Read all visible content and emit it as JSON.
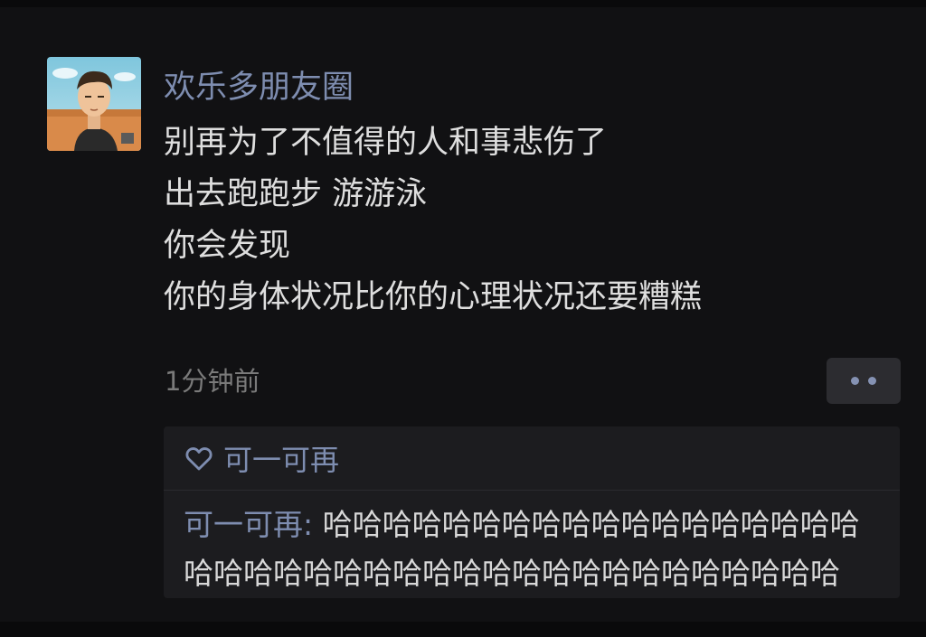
{
  "post": {
    "username": "欢乐多朋友圈",
    "lines": [
      "别再为了不值得的人和事悲伤了",
      "出去跑跑步 游游泳",
      "你会发现",
      "你的身体状况比你的心理状况还要糟糕"
    ],
    "timestamp": "1分钟前"
  },
  "likes": {
    "names": "可一可再"
  },
  "comment": {
    "author": "可一可再",
    "separator": ": ",
    "text": "哈哈哈哈哈哈哈哈哈哈哈哈哈哈哈哈哈哈哈哈哈哈哈哈哈哈哈哈哈哈哈哈哈哈哈哈哈哈哈哈"
  },
  "colors": {
    "background": "#111113",
    "name_link": "#7e8db0",
    "body_text": "#dedede",
    "timestamp": "#7a7a7a",
    "comment_bg": "#1c1c1f"
  },
  "icons": {
    "more": "more-dots-icon",
    "like": "heart-outline-icon"
  }
}
